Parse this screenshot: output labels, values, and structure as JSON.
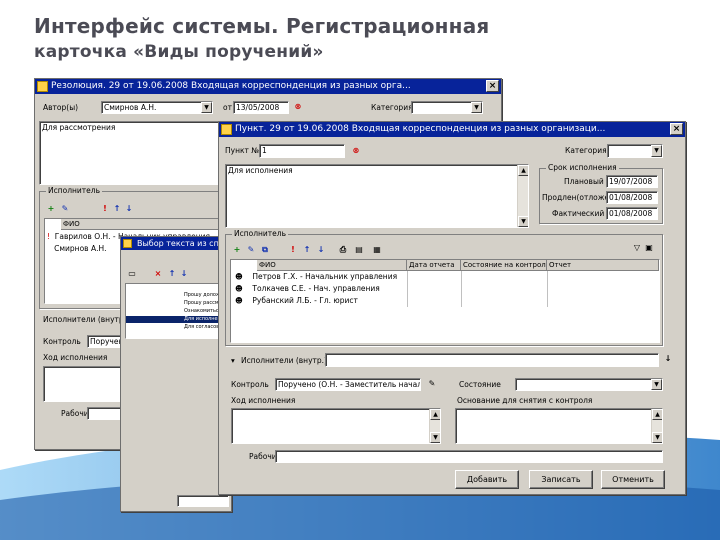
{
  "slide": {
    "title_line1": "Интерфейс системы. Регистрационная",
    "title_line2_a": "карточка «",
    "title_line2_b": "Виды поручений»"
  },
  "back_window": {
    "title": "Резолюция. 29 от 19.06.2008 Входящая корреспонденция из разных орга...",
    "author_label": "Автор(ы) ",
    "author_value": "Смирнов А.Н.",
    "date_label": "от",
    "date_value": "13/05/2008",
    "category_label": "Категория",
    "text": "Для рассмотрения",
    "executor_group": "Исполнитель",
    "grid_header_fio": "ФИО",
    "rows": [
      "Гаврилов О.Н. - Начальник управления",
      "Смирнов А.Н."
    ],
    "executor_ext_label": "Исполнители (внутр.)",
    "control_label": "Контроль",
    "control_value": "Поручено",
    "progress_label": "Ход исполнения",
    "name_label": "Рабочий"
  },
  "mid_window": {
    "title": "Выбор текста из списка",
    "items": [
      "Прошу доложить",
      "Прошу рассмотреть",
      "Ознакомиться",
      "Для исполнения",
      "Для согласования"
    ]
  },
  "front_window": {
    "title": "Пункт. 29 от 19.06.2008 Входящая корреспонденция из разных организаци...",
    "punkt_label": "Пункт №",
    "punkt_value": "1",
    "category_label": "Категория",
    "text": "Для исполнения",
    "deadline_group": "Срок исполнения",
    "plan_label": "Плановый",
    "plan_value": "19/07/2008",
    "extended_label": "Продлен(отложен)",
    "extended_value": "01/08/2008",
    "actual_label": "Фактический",
    "actual_value": "01/08/2008",
    "executor_group": "Исполнитель",
    "grid_headers": [
      "ФИО",
      "Дата отчета",
      "Состояние на контроле",
      "Отчет"
    ],
    "rows": [
      "Петров Г.Х. - Начальник управления",
      "Толкачев С.Е. - Нач. управления",
      "Рубанский Л.Б. - Гл. юрист"
    ],
    "executor_ext_label": "Исполнители (внутр.)",
    "control_label": "Контроль",
    "control_value": "Поручено (О.Н. - Заместитель начальника)",
    "state_label": "Состояние",
    "progress_label": "Ход исполнения",
    "basis_label": "Основание для снятия с контроля",
    "name_label": "Рабочий",
    "buttons": {
      "add": "Добавить",
      "save": "Записать",
      "cancel": "Отменить"
    }
  },
  "colors": {
    "titlebar": "#07239a",
    "window_face": "#d4d0c8",
    "selection": "#0a246a",
    "slide_title": "#4b4b55",
    "swoosh": "#3f9fe0"
  }
}
